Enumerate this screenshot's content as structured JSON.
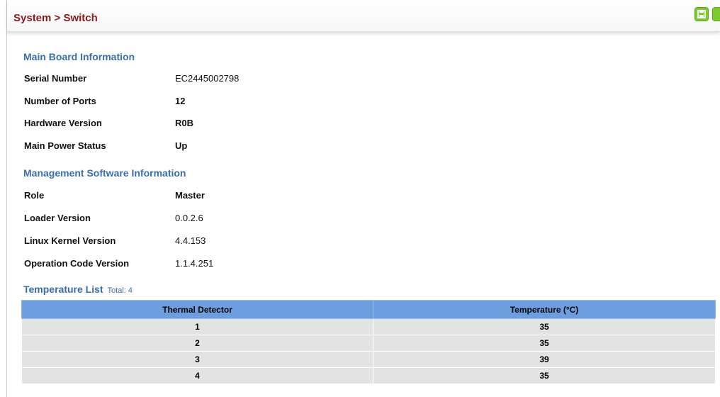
{
  "header": {
    "title": "System > Switch"
  },
  "main_board": {
    "title": "Main Board Information",
    "rows": [
      {
        "label": "Serial Number",
        "value": "EC2445002798"
      },
      {
        "label": "Number of Ports",
        "value": "12"
      },
      {
        "label": "Hardware Version",
        "value": "R0B"
      },
      {
        "label": "Main Power Status",
        "value": "Up"
      }
    ]
  },
  "mgmt_software": {
    "title": "Management Software Information",
    "rows": [
      {
        "label": "Role",
        "value": "Master"
      },
      {
        "label": "Loader Version",
        "value": "0.0.2.6"
      },
      {
        "label": "Linux Kernel Version",
        "value": "4.4.153"
      },
      {
        "label": "Operation Code Version",
        "value": "1.1.4.251"
      }
    ]
  },
  "temperature": {
    "title": "Temperature List",
    "total": "Total: 4",
    "columns": [
      "Thermal Detector",
      "Temperature (°C)"
    ],
    "rows": [
      [
        "1",
        "35"
      ],
      [
        "2",
        "35"
      ],
      [
        "3",
        "39"
      ],
      [
        "4",
        "35"
      ]
    ]
  },
  "icons": {
    "save": "save-icon",
    "help": "help-icon"
  },
  "colors": {
    "title_red": "#8b1a1a",
    "section_blue": "#3a6db0",
    "table_header": "#6d9ee0",
    "row_bg": "#e3e3e3",
    "icon_green": "#7ccb2e"
  }
}
